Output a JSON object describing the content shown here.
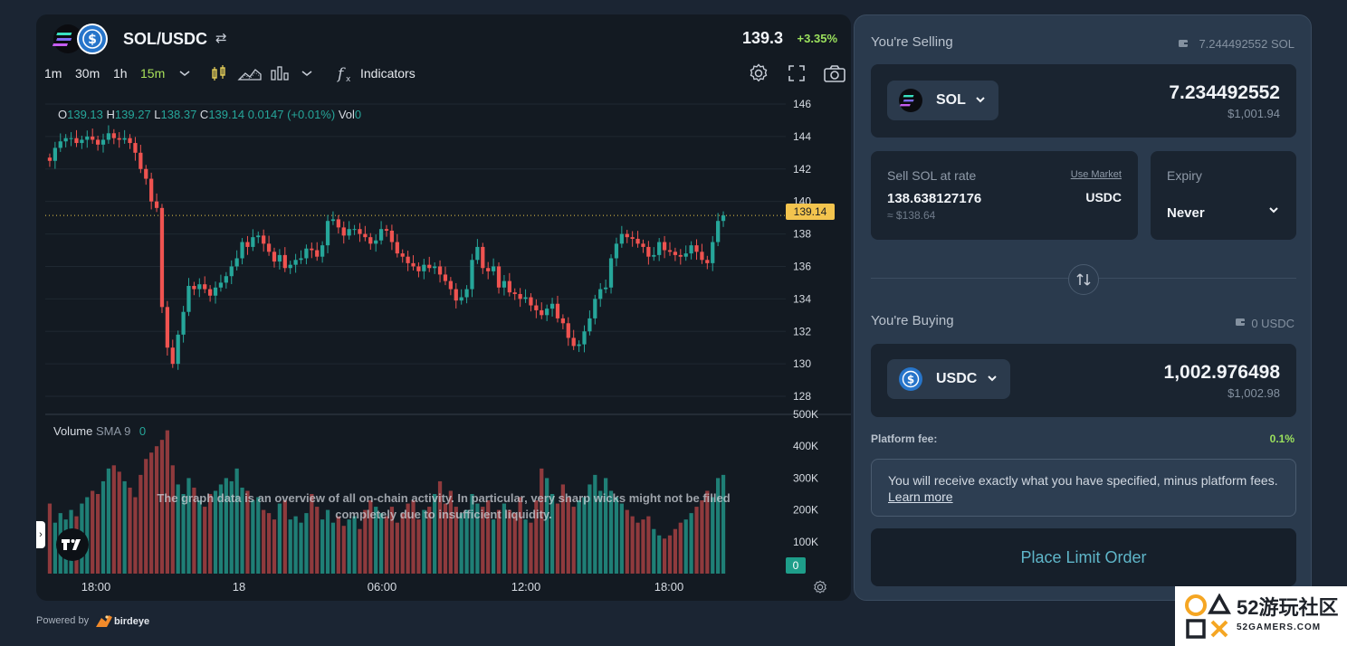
{
  "header": {
    "pair": "SOL/USDC",
    "price": "139.3",
    "change": "+3.35%"
  },
  "toolbar": {
    "timeframes": [
      "1m",
      "30m",
      "1h",
      "15m"
    ],
    "active_timeframe": "15m",
    "indicators_label": "Indicators"
  },
  "ohlc": {
    "o_label": "O",
    "o": "139.13",
    "h_label": "H",
    "h": "139.27",
    "l_label": "L",
    "l": "138.37",
    "c_label": "C",
    "c": "139.14",
    "change": "0.0147 (+0.01%)",
    "vol_label": "Vol",
    "vol": "0"
  },
  "volume_legend": {
    "label": "Volume",
    "sma": "SMA 9",
    "value": "0"
  },
  "chart_data": {
    "type": "candlestick",
    "y_ticks": [
      "146",
      "144",
      "142",
      "140",
      "138",
      "136",
      "134",
      "132",
      "130",
      "128"
    ],
    "volume_ticks": [
      "500K",
      "400K",
      "300K",
      "200K",
      "100K"
    ],
    "x_ticks": [
      "18:00",
      "18",
      "06:00",
      "12:00",
      "18:00"
    ],
    "ylim": [
      127,
      146.5
    ],
    "volume_ylim": [
      0,
      500000
    ],
    "last_price": "139.14",
    "last_volume": "0",
    "up_color": "#26a69a",
    "down_color": "#ef5350",
    "close": [
      142.5,
      143.3,
      143.7,
      143.9,
      143.9,
      143.6,
      143.8,
      144.0,
      143.8,
      143.5,
      143.8,
      144.2,
      143.9,
      143.8,
      143.9,
      143.6,
      143.0,
      142.0,
      141.4,
      140.0,
      139.6,
      133.5,
      131.0,
      130.0,
      131.8,
      133.2,
      134.8,
      134.6,
      134.9,
      134.6,
      134.2,
      134.7,
      135.0,
      135.4,
      136.0,
      136.5,
      137.5,
      137.2,
      137.8,
      137.9,
      137.4,
      136.9,
      136.3,
      136.7,
      135.9,
      136.1,
      136.4,
      136.5,
      137.1,
      137.0,
      136.6,
      137.3,
      138.8,
      138.9,
      138.4,
      137.9,
      138.3,
      138.3,
      138.0,
      137.8,
      137.4,
      137.6,
      138.3,
      138.2,
      137.5,
      136.8,
      136.6,
      136.2,
      136.0,
      135.7,
      136.1,
      135.9,
      136.0,
      135.5,
      135.1,
      134.6,
      133.9,
      134.1,
      134.6,
      136.4,
      137.2,
      135.9,
      135.7,
      136.0,
      134.7,
      135.1,
      134.4,
      134.3,
      134.0,
      134.1,
      133.6,
      133.3,
      133.0,
      133.4,
      133.7,
      132.8,
      132.5,
      131.6,
      131.1,
      131.2,
      132.0,
      132.8,
      134.0,
      134.6,
      134.7,
      136.5,
      137.4,
      138.0,
      137.8,
      137.7,
      137.4,
      137.2,
      136.6,
      136.7,
      137.5,
      137.0,
      136.9,
      136.7,
      136.6,
      136.8,
      137.3,
      136.9,
      136.4,
      136.2,
      137.5,
      138.8,
      139.14
    ],
    "volume": [
      220000,
      160000,
      190000,
      170000,
      200000,
      180000,
      220000,
      240000,
      260000,
      250000,
      290000,
      330000,
      340000,
      320000,
      290000,
      270000,
      240000,
      310000,
      360000,
      380000,
      400000,
      420000,
      450000,
      340000,
      280000,
      250000,
      300000,
      270000,
      230000,
      210000,
      250000,
      260000,
      280000,
      300000,
      290000,
      330000,
      270000,
      260000,
      230000,
      240000,
      200000,
      190000,
      170000,
      220000,
      230000,
      170000,
      180000,
      160000,
      190000,
      250000,
      210000,
      170000,
      200000,
      160000,
      180000,
      150000,
      170000,
      180000,
      140000,
      200000,
      230000,
      210000,
      190000,
      180000,
      210000,
      160000,
      190000,
      220000,
      230000,
      170000,
      200000,
      210000,
      250000,
      290000,
      220000,
      260000,
      210000,
      190000,
      200000,
      250000,
      220000,
      210000,
      230000,
      170000,
      200000,
      220000,
      200000,
      190000,
      240000,
      170000,
      160000,
      230000,
      330000,
      300000,
      250000,
      220000,
      280000,
      240000,
      210000,
      230000,
      240000,
      280000,
      310000,
      260000,
      300000,
      260000,
      240000,
      220000,
      200000,
      180000,
      160000,
      170000,
      180000,
      140000,
      120000,
      110000,
      120000,
      140000,
      160000,
      170000,
      190000,
      210000,
      230000,
      260000,
      240000,
      300000,
      310000
    ]
  },
  "overlay": {
    "note_line1": "The graph data is an overview of all on-chain activity. In particular, very sharp wicks might not be filled",
    "note_line2": "completely due to insufficient liquidity."
  },
  "footer": {
    "powered_by": "Powered by",
    "brand": "birdeye"
  },
  "selling": {
    "label": "You're Selling",
    "balance": "7.244492552 SOL",
    "token": "SOL",
    "amount": "7.234492552",
    "usd": "$1,001.94"
  },
  "rate": {
    "label": "Sell SOL at rate",
    "use_market": "Use Market",
    "value": "138.638127176",
    "approx": "≈ $138.64",
    "quote": "USDC"
  },
  "expiry": {
    "label": "Expiry",
    "value": "Never"
  },
  "buying": {
    "label": "You're Buying",
    "balance": "0 USDC",
    "token": "USDC",
    "amount": "1,002.976498",
    "usd": "$1,002.98"
  },
  "fee": {
    "label": "Platform fee:",
    "value": "0.1%"
  },
  "info": {
    "text": "You will receive exactly what you have specified, minus platform fees.",
    "link": "Learn more"
  },
  "action": {
    "label": "Place Limit Order"
  },
  "watermark": {
    "number": "52游玩社区",
    "site": "52GAMERS.COM"
  }
}
